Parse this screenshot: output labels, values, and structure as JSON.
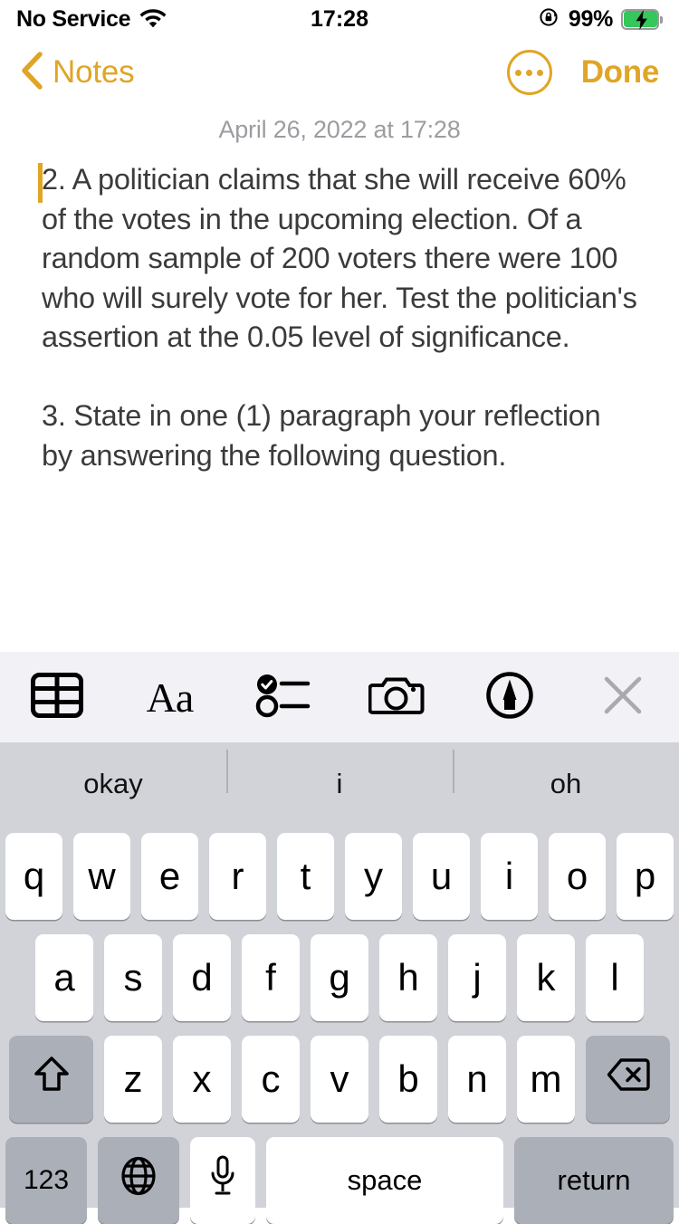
{
  "status_bar": {
    "carrier": "No Service",
    "wifi_icon": "wifi-icon",
    "time": "17:28",
    "rotation_lock_icon": "rotation-lock-icon",
    "battery_percent": "99%",
    "battery_icon": "battery-charging-icon",
    "battery_color": "#34C759"
  },
  "nav_bar": {
    "back_icon": "chevron-left-icon",
    "back_label": "Notes",
    "more_icon": "ellipsis-circle-icon",
    "done_label": "Done",
    "accent_color": "#E0A526"
  },
  "note": {
    "date": "April 26, 2022 at 17:28",
    "caret_color": "#E0A526",
    "paragraphs": [
      "2. A politician claims that she will receive 60% of the votes in the upcoming election. Of a random sample of 200 voters there were 100 who will surely vote for her. Test the politician's assertion at the 0.05 level of significance.",
      "3. State in one (1) paragraph your reflection by answering the following question."
    ]
  },
  "format_toolbar": {
    "background": "#F2F1F6",
    "buttons": [
      {
        "name": "table-icon",
        "label": ""
      },
      {
        "name": "text-format-icon",
        "label": "Aa"
      },
      {
        "name": "checklist-icon",
        "label": ""
      },
      {
        "name": "camera-icon",
        "label": ""
      },
      {
        "name": "markup-pen-icon",
        "label": ""
      },
      {
        "name": "close-icon",
        "label": ""
      }
    ]
  },
  "keyboard": {
    "background": "#D1D3D9",
    "predictions": [
      "okay",
      "i",
      "oh"
    ],
    "row1": [
      "q",
      "w",
      "e",
      "r",
      "t",
      "y",
      "u",
      "i",
      "o",
      "p"
    ],
    "row2": [
      "a",
      "s",
      "d",
      "f",
      "g",
      "h",
      "j",
      "k",
      "l"
    ],
    "row3": [
      "z",
      "x",
      "c",
      "v",
      "b",
      "n",
      "m"
    ],
    "shift_icon": "shift-icon",
    "delete_icon": "backspace-icon",
    "numbers_label": "123",
    "globe_icon": "globe-icon",
    "mic_icon": "microphone-icon",
    "space_label": "space",
    "return_label": "return"
  }
}
